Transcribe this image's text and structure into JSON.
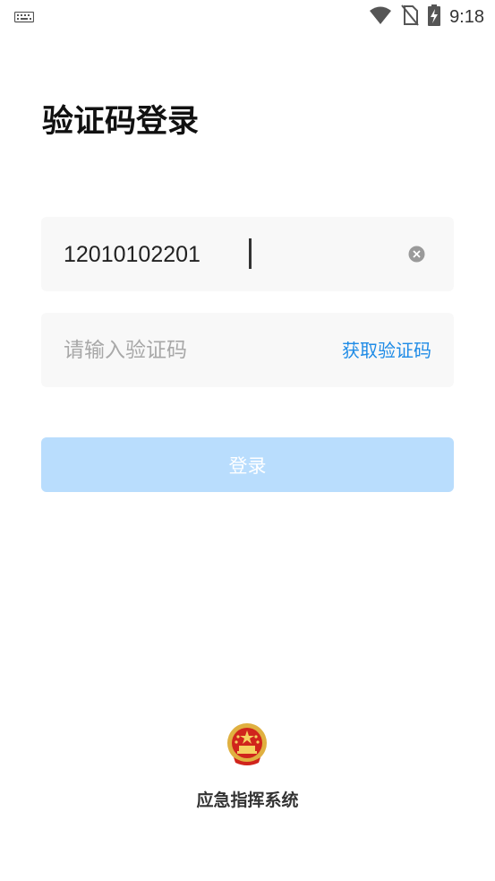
{
  "status_bar": {
    "time": "9:18",
    "icons": [
      "keyboard-icon",
      "wifi-icon",
      "no-sim-icon",
      "battery-charging-icon"
    ]
  },
  "page": {
    "title": "验证码登录"
  },
  "phone_field": {
    "value": "12010102201",
    "clear_icon": "clear-circle-icon"
  },
  "code_field": {
    "placeholder": "请输入验证码",
    "get_code_label": "获取验证码"
  },
  "login_button": {
    "label": "登录",
    "color": "#B9DDFD"
  },
  "footer": {
    "emblem_icon": "national-emblem-icon",
    "app_name": "应急指挥系统"
  },
  "colors": {
    "accent": "#1E8BE6",
    "field_bg": "#F8F8F8"
  }
}
